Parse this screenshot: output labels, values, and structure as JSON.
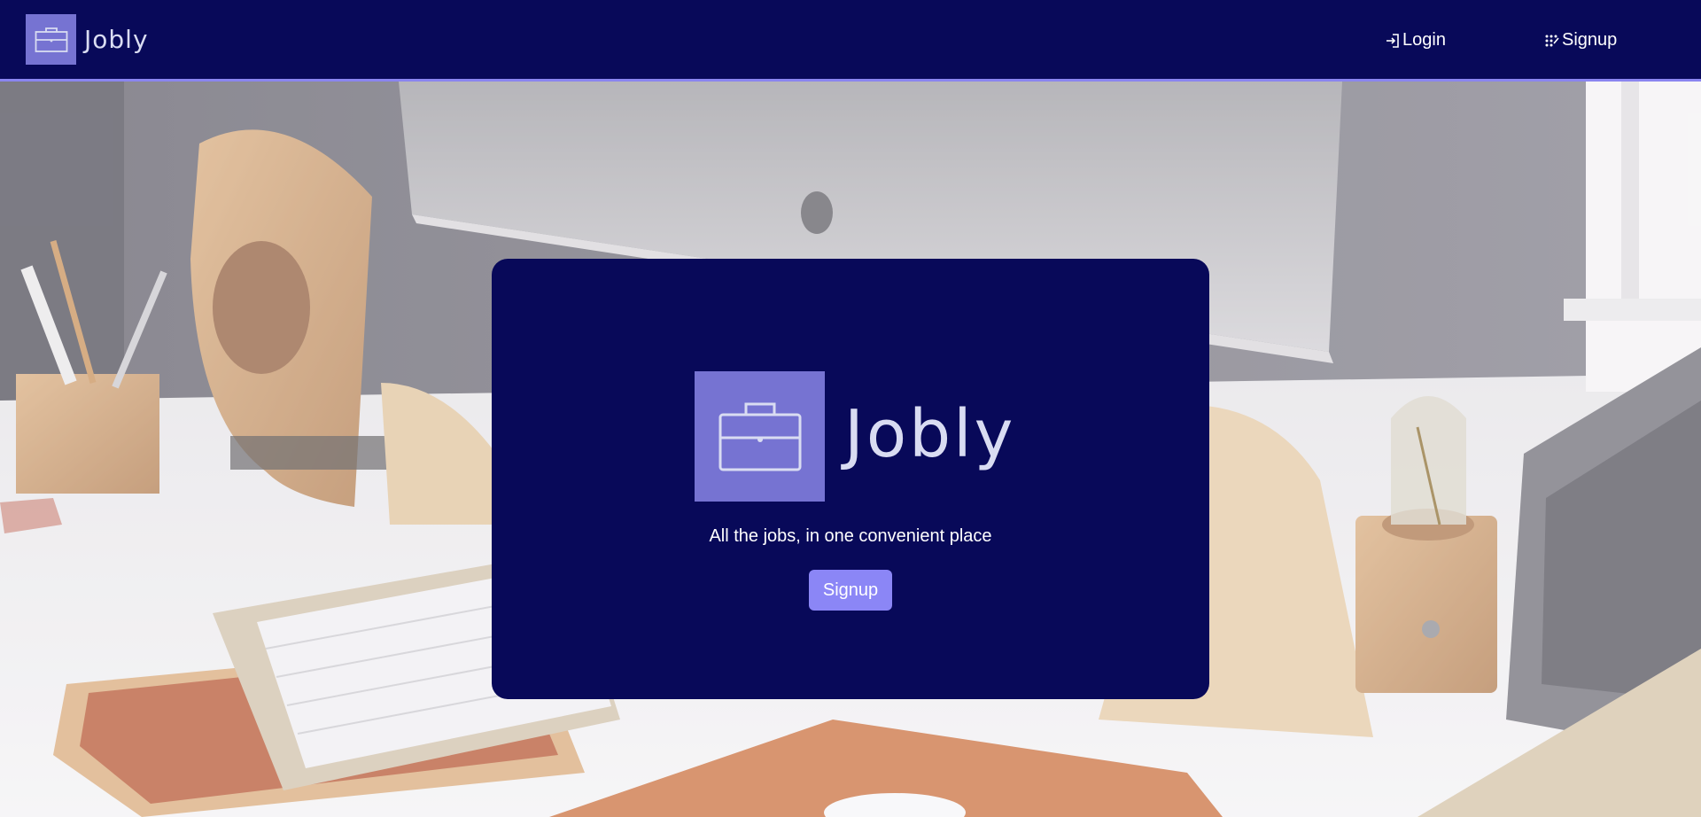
{
  "navbar": {
    "brand_name": "Jobly",
    "brand_icon": "briefcase-icon",
    "login_label": "Login",
    "login_icon": "login-arrow-icon",
    "signup_label": "Signup",
    "signup_icon": "dotted-grid-icon"
  },
  "hero": {
    "title": "Jobly",
    "logo_icon": "briefcase-icon",
    "tagline": "All the jobs, in one convenient place",
    "signup_button": "Signup"
  },
  "colors": {
    "navy": "#080959",
    "brand_purple": "#7673d2",
    "button_purple": "#8b86f6",
    "nav_border": "#8a85f0",
    "title_text": "#d9dcf2"
  },
  "background": {
    "scene": "workspace-desk-photo"
  }
}
